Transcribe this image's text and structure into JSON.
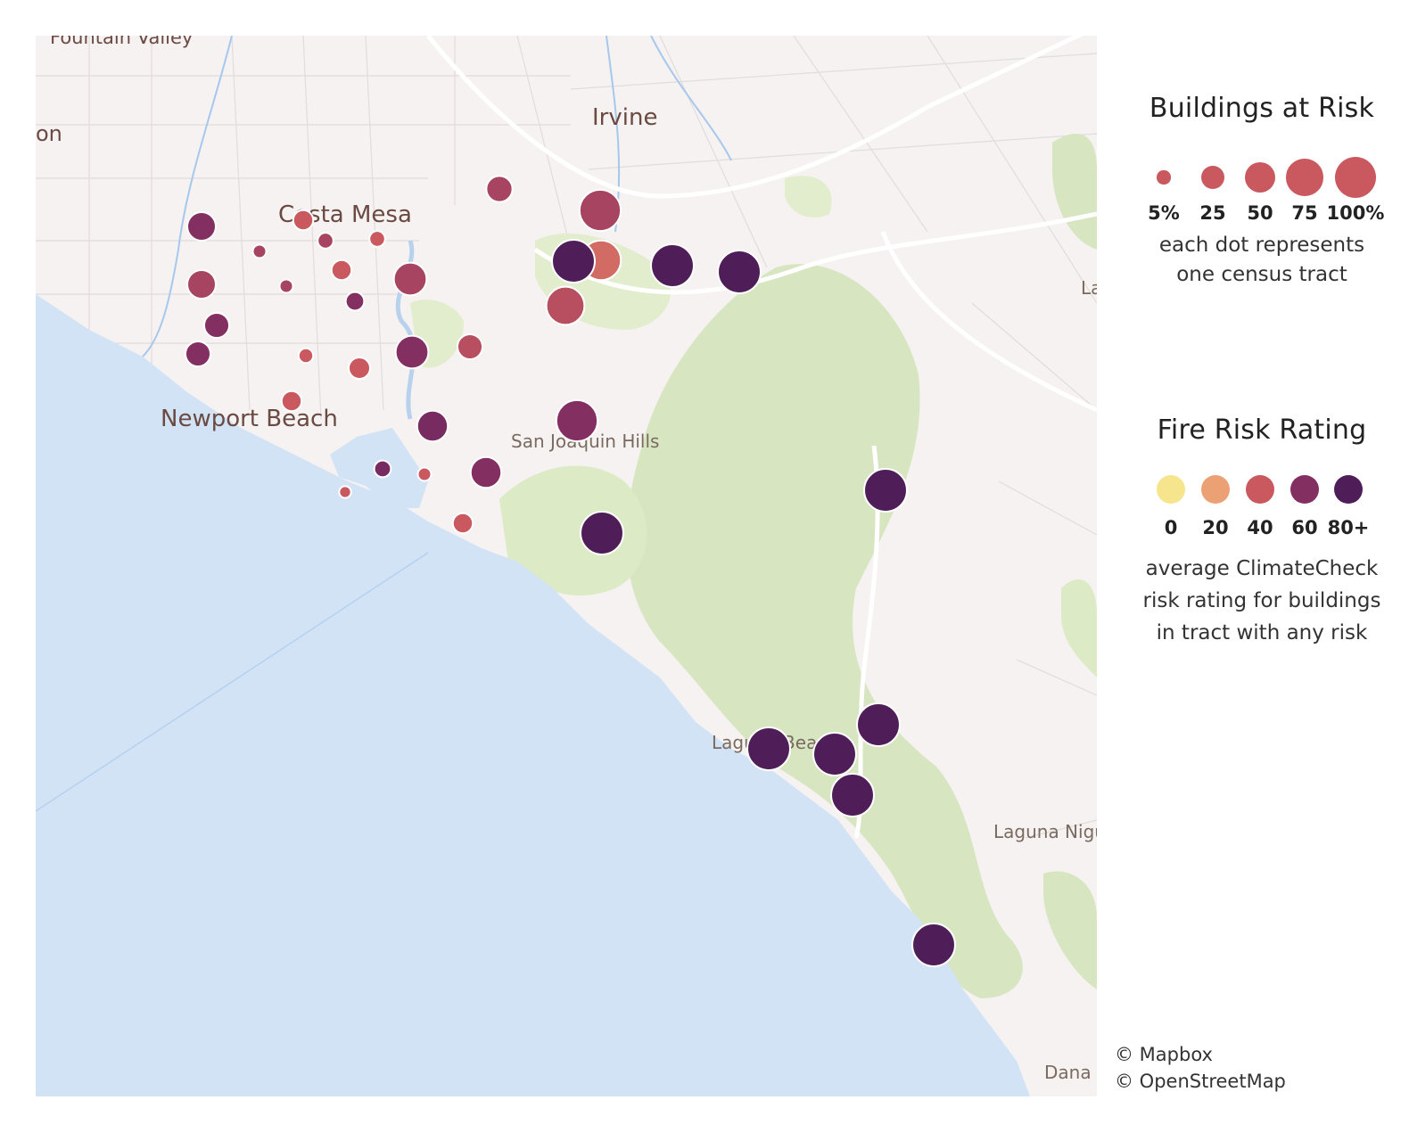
{
  "map": {
    "place_labels": [
      {
        "id": "fountain-valley",
        "text": "Fountain Valley"
      },
      {
        "id": "irvine",
        "text": "Irvine"
      },
      {
        "id": "costa-mesa",
        "text": "Costa Mesa"
      },
      {
        "id": "newport-beach",
        "text": "Newport Beach"
      },
      {
        "id": "san-joaquin-hills",
        "text": "San Joaquin Hills"
      },
      {
        "id": "laguna-beach",
        "text": "Laguna Beach"
      },
      {
        "id": "laguna-niguel",
        "text": "Laguna Nigu"
      },
      {
        "id": "dana-point",
        "text": "Dana P"
      },
      {
        "id": "edge-on",
        "text": "on"
      },
      {
        "id": "edge-la",
        "text": "La"
      }
    ],
    "tracts": [
      {
        "size": 25,
        "rating": 60
      },
      {
        "size": 10,
        "rating": 40
      },
      {
        "size": 5,
        "rating": 50
      },
      {
        "size": 5,
        "rating": 40
      },
      {
        "size": 3,
        "rating": 50
      },
      {
        "size": 25,
        "rating": 50
      },
      {
        "size": 10,
        "rating": 40
      },
      {
        "size": 3,
        "rating": 50
      },
      {
        "size": 8,
        "rating": 60
      },
      {
        "size": 35,
        "rating": 50
      },
      {
        "size": 18,
        "rating": 60
      },
      {
        "size": 18,
        "rating": 60
      },
      {
        "size": 35,
        "rating": 60
      },
      {
        "size": 18,
        "rating": 45
      },
      {
        "size": 4,
        "rating": 40
      },
      {
        "size": 12,
        "rating": 40
      },
      {
        "size": 10,
        "rating": 40
      },
      {
        "size": 45,
        "rating": 65
      },
      {
        "size": 45,
        "rating": 45
      },
      {
        "size": 30,
        "rating": 65
      },
      {
        "size": 6,
        "rating": 65
      },
      {
        "size": 3,
        "rating": 40
      },
      {
        "size": 2,
        "rating": 40
      },
      {
        "size": 30,
        "rating": 60
      },
      {
        "size": 10,
        "rating": 40
      },
      {
        "size": 60,
        "rating": 50
      },
      {
        "size": 20,
        "rating": 50
      },
      {
        "size": 55,
        "rating": 35
      },
      {
        "size": 50,
        "rating": 45
      },
      {
        "size": 60,
        "rating": 60
      },
      {
        "size": 65,
        "rating": 80
      },
      {
        "size": 65,
        "rating": 80
      },
      {
        "size": 65,
        "rating": 80
      },
      {
        "size": 65,
        "rating": 80
      },
      {
        "size": 65,
        "rating": 80
      },
      {
        "size": 65,
        "rating": 80
      },
      {
        "size": 65,
        "rating": 80
      },
      {
        "size": 65,
        "rating": 80
      },
      {
        "size": 65,
        "rating": 80
      },
      {
        "size": 65,
        "rating": 80
      }
    ]
  },
  "legend": {
    "size_title": "Buildings at Risk",
    "sizes": [
      {
        "label": "5%",
        "value": 5
      },
      {
        "label": "25",
        "value": 25
      },
      {
        "label": "50",
        "value": 50
      },
      {
        "label": "75",
        "value": 75
      },
      {
        "label": "100%",
        "value": 100
      }
    ],
    "size_note": [
      "each dot represents",
      "one census tract"
    ],
    "color_title": "Fire Risk Rating",
    "colors": [
      {
        "label": "0",
        "value": 0,
        "color": "#f6e58d"
      },
      {
        "label": "20",
        "value": 20,
        "color": "#eba173"
      },
      {
        "label": "40",
        "value": 40,
        "color": "#c9595f"
      },
      {
        "label": "60",
        "value": 60,
        "color": "#842f62"
      },
      {
        "label": "80+",
        "value": 80,
        "color": "#4f1e58"
      }
    ],
    "color_note": [
      "average ClimateCheck",
      "risk rating for buildings",
      "in tract with any risk"
    ]
  },
  "credits": [
    "© Mapbox",
    "© OpenStreetMap"
  ]
}
